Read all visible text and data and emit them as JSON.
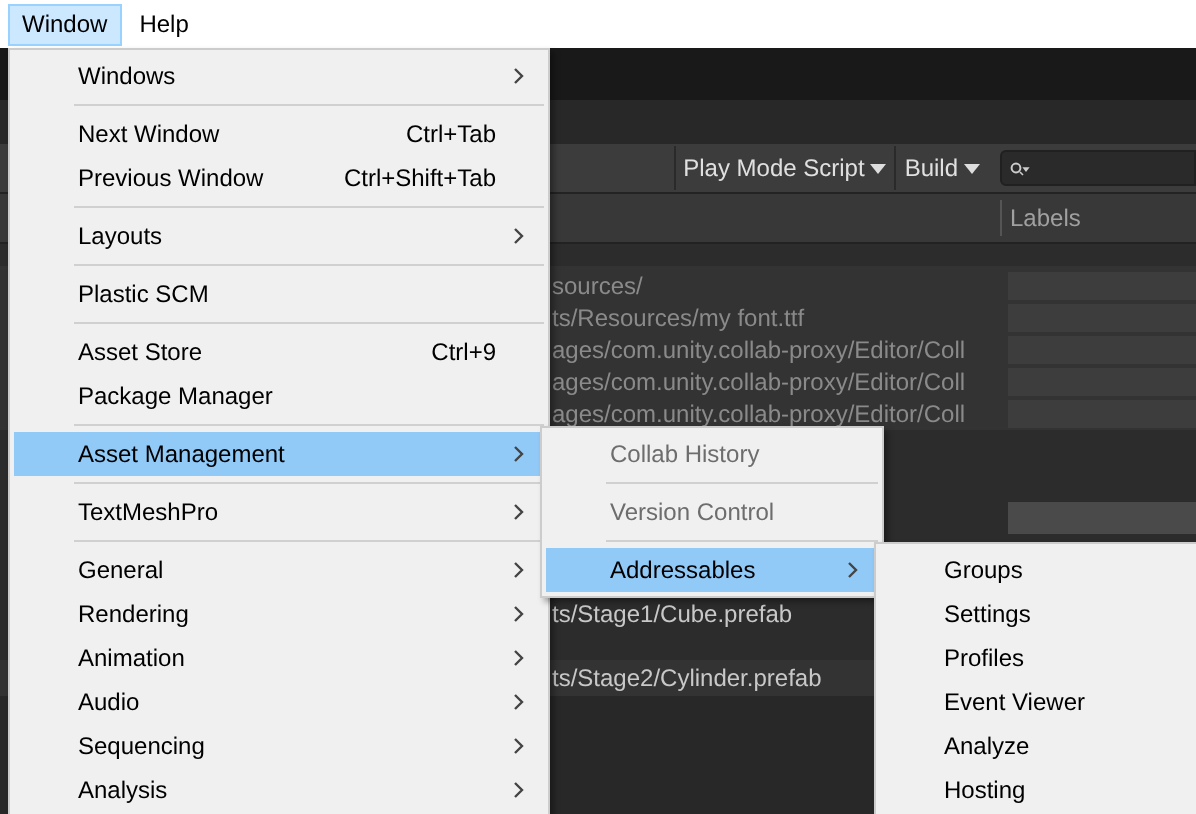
{
  "menubar": [
    {
      "label": "Window",
      "selected": true
    },
    {
      "label": "Help",
      "selected": false
    }
  ],
  "toolbar": {
    "dropdowns": [
      "Play Mode Script",
      "Build"
    ]
  },
  "table": {
    "header": "Labels",
    "rows": [
      {
        "path": "sources/"
      },
      {
        "path": "ts/Resources/my font.ttf"
      },
      {
        "path": "ages/com.unity.collab-proxy/Editor/Coll"
      },
      {
        "path": "ages/com.unity.collab-proxy/Editor/Coll"
      },
      {
        "path": "ages/com.unity.collab-proxy/Editor/Coll"
      }
    ],
    "rows2": [
      {
        "path": "ts/Stage1/Cube.prefab"
      },
      {
        "path": "ts/Stage2/Cylinder.prefab"
      }
    ]
  },
  "menu": [
    {
      "kind": "item",
      "label": "Windows",
      "submenu": true,
      "selected": false
    },
    {
      "kind": "separator"
    },
    {
      "kind": "item",
      "label": "Next Window",
      "shortcut": "Ctrl+Tab",
      "submenu": false,
      "selected": false
    },
    {
      "kind": "item",
      "label": "Previous Window",
      "shortcut": "Ctrl+Shift+Tab",
      "submenu": false,
      "selected": false
    },
    {
      "kind": "separator"
    },
    {
      "kind": "item",
      "label": "Layouts",
      "submenu": true,
      "selected": false
    },
    {
      "kind": "separator"
    },
    {
      "kind": "item",
      "label": "Plastic SCM",
      "submenu": false,
      "selected": false
    },
    {
      "kind": "separator"
    },
    {
      "kind": "item",
      "label": "Asset Store",
      "shortcut": "Ctrl+9",
      "submenu": false,
      "selected": false
    },
    {
      "kind": "item",
      "label": "Package Manager",
      "submenu": false,
      "selected": false
    },
    {
      "kind": "separator"
    },
    {
      "kind": "item",
      "label": "Asset Management",
      "submenu": true,
      "selected": true
    },
    {
      "kind": "separator"
    },
    {
      "kind": "item",
      "label": "TextMeshPro",
      "submenu": true,
      "selected": false
    },
    {
      "kind": "separator"
    },
    {
      "kind": "item",
      "label": "General",
      "submenu": true,
      "selected": false
    },
    {
      "kind": "item",
      "label": "Rendering",
      "submenu": true,
      "selected": false
    },
    {
      "kind": "item",
      "label": "Animation",
      "submenu": true,
      "selected": false
    },
    {
      "kind": "item",
      "label": "Audio",
      "submenu": true,
      "selected": false
    },
    {
      "kind": "item",
      "label": "Sequencing",
      "submenu": true,
      "selected": false
    },
    {
      "kind": "item",
      "label": "Analysis",
      "submenu": true,
      "selected": false
    }
  ],
  "submenu": [
    {
      "kind": "item",
      "label": "Collab History",
      "disabled": true,
      "submenu": false,
      "selected": false
    },
    {
      "kind": "separator"
    },
    {
      "kind": "item",
      "label": "Version Control",
      "disabled": true,
      "submenu": false,
      "selected": false
    },
    {
      "kind": "separator"
    },
    {
      "kind": "item",
      "label": "Addressables",
      "disabled": false,
      "submenu": true,
      "selected": true
    }
  ],
  "submenu2": [
    {
      "kind": "item",
      "label": "Groups",
      "submenu": false,
      "selected": false
    },
    {
      "kind": "item",
      "label": "Settings",
      "submenu": false,
      "selected": false
    },
    {
      "kind": "item",
      "label": "Profiles",
      "submenu": false,
      "selected": false
    },
    {
      "kind": "item",
      "label": "Event Viewer",
      "submenu": false,
      "selected": false
    },
    {
      "kind": "item",
      "label": "Analyze",
      "submenu": false,
      "selected": false
    },
    {
      "kind": "item",
      "label": "Hosting",
      "submenu": false,
      "selected": false
    }
  ]
}
